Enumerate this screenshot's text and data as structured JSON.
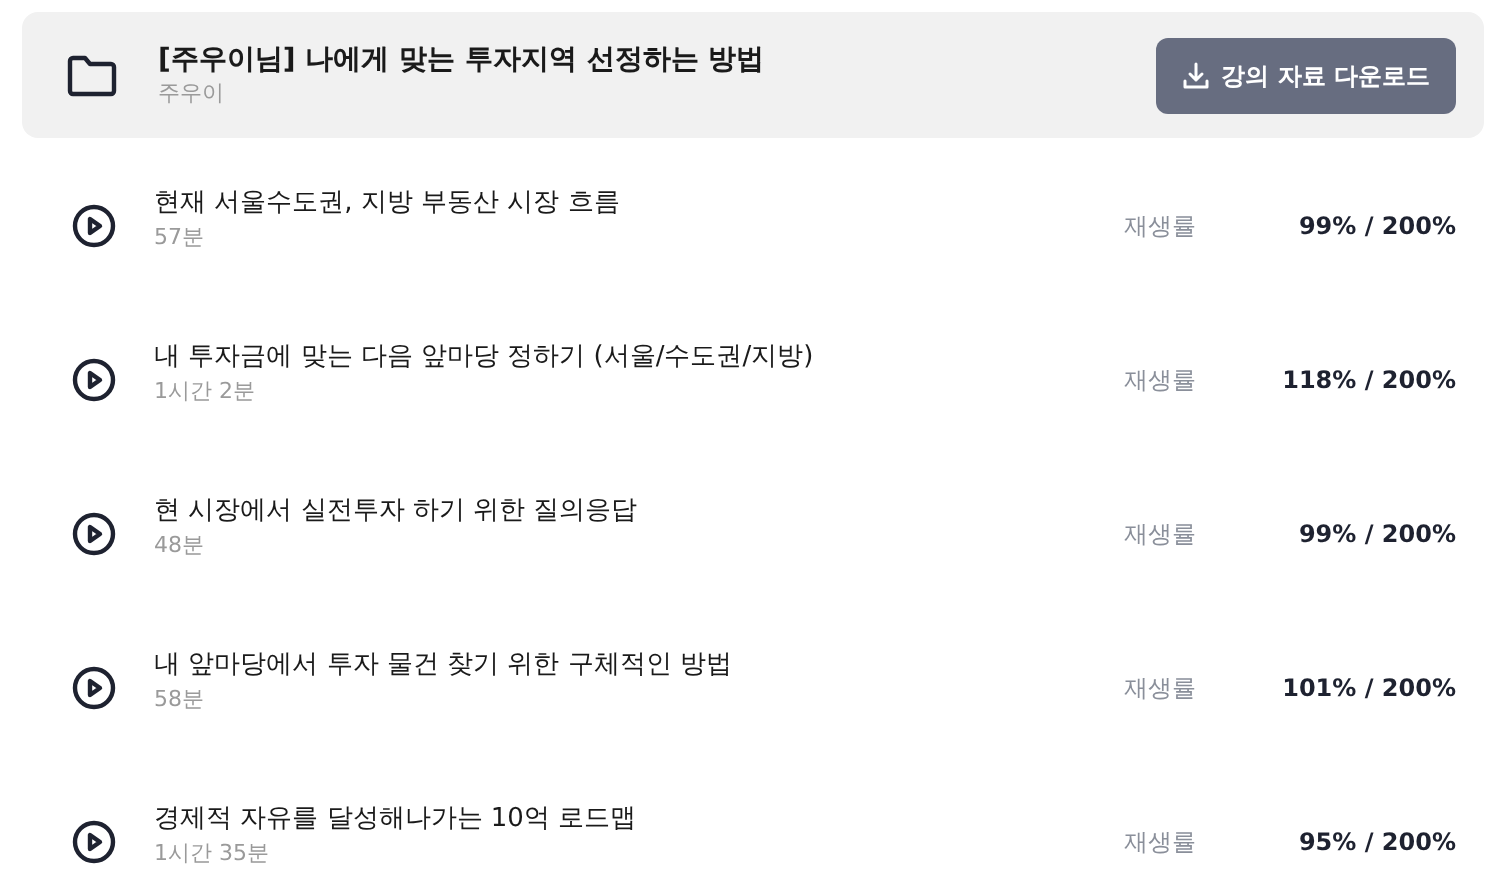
{
  "course": {
    "title": "[주우이님] 나에게 맞는 투자지역 선정하는 방법",
    "author": "주우이",
    "download_button": "강의 자료 다운로드"
  },
  "lectures": [
    {
      "title": "현재 서울수도권, 지방 부동산 시장 흐름",
      "duration": "57분",
      "progress_label": "재생률",
      "progress": "99% / 200%"
    },
    {
      "title": "내 투자금에 맞는 다음 앞마당 정하기 (서울/수도권/지방)",
      "duration": "1시간 2분",
      "progress_label": "재생률",
      "progress": "118% / 200%"
    },
    {
      "title": "현 시장에서 실전투자 하기 위한 질의응답",
      "duration": "48분",
      "progress_label": "재생률",
      "progress": "99% / 200%"
    },
    {
      "title": "내 앞마당에서 투자 물건 찾기 위한 구체적인 방법",
      "duration": "58분",
      "progress_label": "재생률",
      "progress": "101% / 200%"
    },
    {
      "title": "경제적 자유를 달성해나가는 10억 로드맵",
      "duration": "1시간 35분",
      "progress_label": "재생률",
      "progress": "95% / 200%"
    }
  ]
}
